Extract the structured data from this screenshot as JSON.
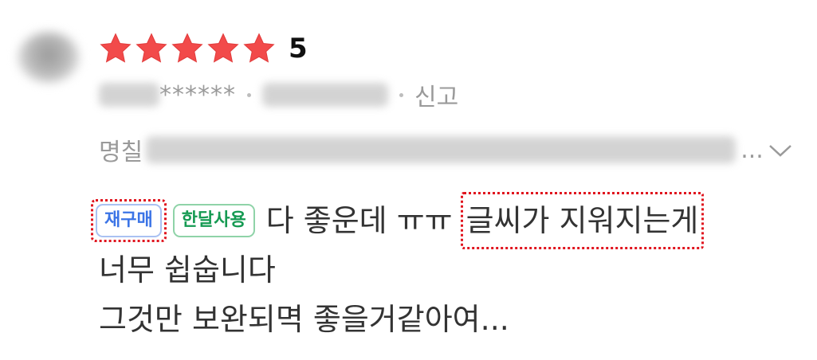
{
  "review": {
    "rating": {
      "stars_filled": 5,
      "stars_total": 5,
      "star_color": "#f24a4a",
      "score_label": "5"
    },
    "meta": {
      "masked_id": "******",
      "report_label": "신고"
    },
    "option": {
      "label_prefix": "명칠",
      "ellipsis": "..."
    },
    "badges": [
      {
        "label": "재구매",
        "color": "#3b74e6"
      },
      {
        "label": "한달사용",
        "color": "#159a52"
      }
    ],
    "content": {
      "line1_text": "다 좋운데 ㅠㅠ",
      "highlight_text": "글씨가 지워지는게",
      "line2": "너무 쉽숩니다",
      "line3": "그것만 보완되멱 좋을거같아여..."
    },
    "annotation_color": "#e0141e"
  }
}
